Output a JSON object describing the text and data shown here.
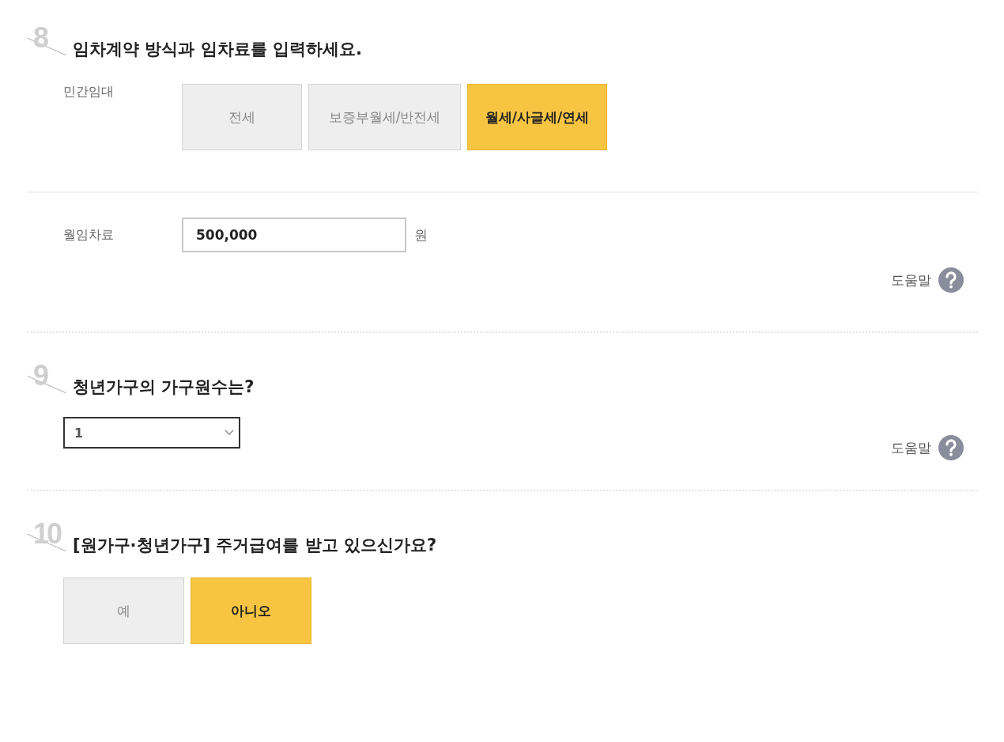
{
  "q8": {
    "number": "8",
    "title": "임차계약 방식과 임차료를 입력하세요.",
    "label": "민간임대",
    "options": [
      {
        "label": "전세",
        "selected": false
      },
      {
        "label": "보증부월세/반전세",
        "selected": false
      },
      {
        "label": "월세/사글세/연세",
        "selected": true
      }
    ],
    "rent": {
      "label": "월임차료",
      "value": "500,000",
      "unit": "원"
    },
    "help": "도움말"
  },
  "q9": {
    "number": "9",
    "title": "청년가구의 가구원수는?",
    "select": {
      "value": "1"
    },
    "help": "도움말"
  },
  "q10": {
    "number": "10",
    "title": "[원가구·청년가구] 주거급여를 받고 있으신가요?",
    "options": [
      {
        "label": "예",
        "selected": false
      },
      {
        "label": "아니오",
        "selected": true
      }
    ]
  }
}
